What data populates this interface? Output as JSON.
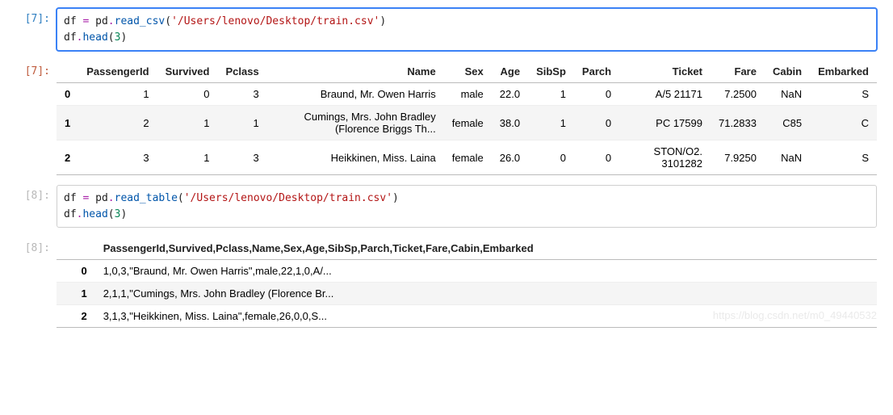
{
  "cells": [
    {
      "prompt_in": "[7]:",
      "prompt_out": "[7]:",
      "code_tokens": [
        [
          "df",
          "var"
        ],
        [
          " ",
          "punct"
        ],
        [
          "=",
          "op"
        ],
        [
          " ",
          "punct"
        ],
        [
          "pd",
          "id"
        ],
        [
          ".",
          "dot"
        ],
        [
          "read_csv",
          "call"
        ],
        [
          "(",
          "punct"
        ],
        [
          "'/Users/lenovo/Desktop/train.csv'",
          "str"
        ],
        [
          ")",
          "punct"
        ],
        [
          "\n",
          "punct"
        ],
        [
          "df",
          "var"
        ],
        [
          ".",
          "dot"
        ],
        [
          "head",
          "call"
        ],
        [
          "(",
          "punct"
        ],
        [
          "3",
          "num"
        ],
        [
          ")",
          "punct"
        ]
      ],
      "selected": true,
      "out_muted": false,
      "table": {
        "columns": [
          "",
          "PassengerId",
          "Survived",
          "Pclass",
          "Name",
          "Sex",
          "Age",
          "SibSp",
          "Parch",
          "Ticket",
          "Fare",
          "Cabin",
          "Embarked"
        ],
        "rows": [
          [
            "0",
            "1",
            "0",
            "3",
            "Braund, Mr. Owen Harris",
            "male",
            "22.0",
            "1",
            "0",
            "A/5 21171",
            "7.2500",
            "NaN",
            "S"
          ],
          [
            "1",
            "2",
            "1",
            "1",
            "Cumings, Mrs. John Bradley (Florence Briggs Th...",
            "female",
            "38.0",
            "1",
            "0",
            "PC 17599",
            "71.2833",
            "C85",
            "C"
          ],
          [
            "2",
            "3",
            "1",
            "3",
            "Heikkinen, Miss. Laina",
            "female",
            "26.0",
            "0",
            "0",
            "STON/O2. 3101282",
            "7.9250",
            "NaN",
            "S"
          ]
        ]
      }
    },
    {
      "prompt_in": "[8]:",
      "prompt_out": "[8]:",
      "code_tokens": [
        [
          "df",
          "var"
        ],
        [
          " ",
          "punct"
        ],
        [
          "=",
          "op"
        ],
        [
          " ",
          "punct"
        ],
        [
          "pd",
          "id"
        ],
        [
          ".",
          "dot"
        ],
        [
          "read_table",
          "call"
        ],
        [
          "(",
          "punct"
        ],
        [
          "'/Users/lenovo/Desktop/train.csv'",
          "str"
        ],
        [
          ")",
          "punct"
        ],
        [
          "\n",
          "punct"
        ],
        [
          "df",
          "var"
        ],
        [
          ".",
          "dot"
        ],
        [
          "head",
          "call"
        ],
        [
          "(",
          "punct"
        ],
        [
          "3",
          "num"
        ],
        [
          ")",
          "punct"
        ]
      ],
      "selected": false,
      "out_muted": true,
      "table": {
        "columns": [
          "",
          "PassengerId,Survived,Pclass,Name,Sex,Age,SibSp,Parch,Ticket,Fare,Cabin,Embarked"
        ],
        "left_cols": [
          1
        ],
        "rows": [
          [
            "0",
            "1,0,3,\"Braund, Mr. Owen Harris\",male,22,1,0,A/..."
          ],
          [
            "1",
            "2,1,1,\"Cumings, Mrs. John Bradley (Florence Br..."
          ],
          [
            "2",
            "3,1,3,\"Heikkinen, Miss. Laina\",female,26,0,0,S..."
          ]
        ]
      }
    }
  ],
  "watermark": "https://blog.csdn.net/m0_49440532"
}
